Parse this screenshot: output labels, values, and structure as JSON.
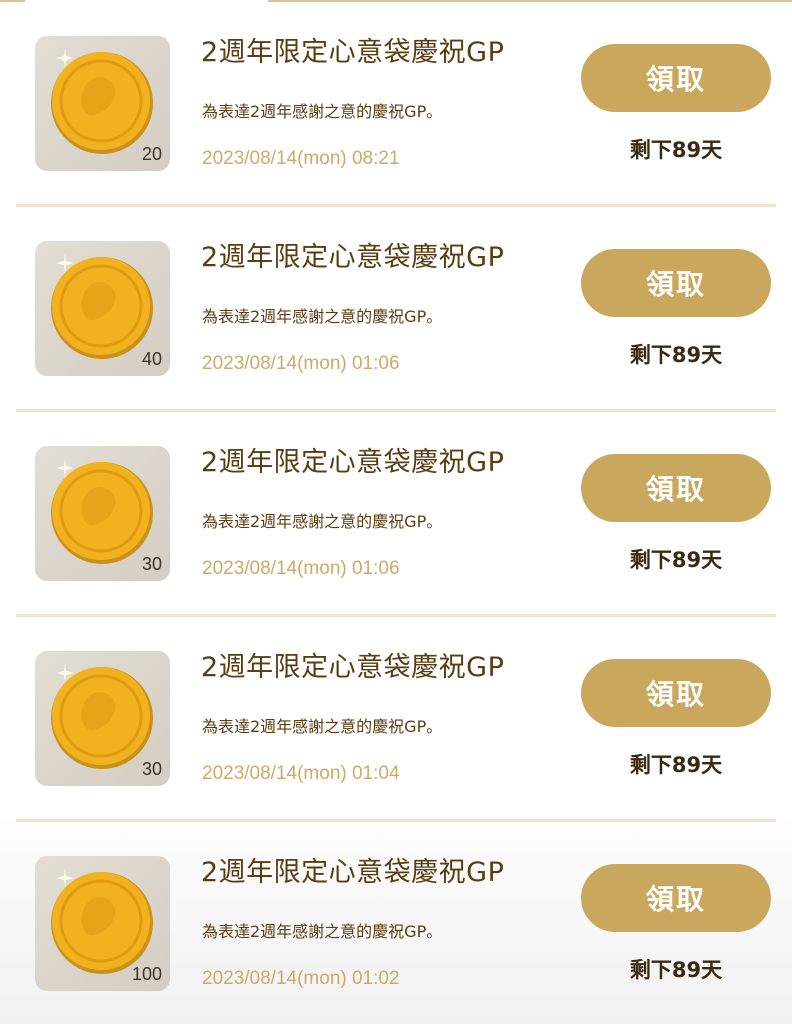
{
  "items": [
    {
      "title": "2週年限定心意袋慶祝GP",
      "desc": "為表達2週年感謝之意的慶祝GP。",
      "date": "2023/08/14(mon) 08:21",
      "count": "20",
      "claim_label": "領取",
      "remaining": "剩下89天",
      "icon": "gold-coin-icon"
    },
    {
      "title": "2週年限定心意袋慶祝GP",
      "desc": "為表達2週年感謝之意的慶祝GP。",
      "date": "2023/08/14(mon) 01:06",
      "count": "40",
      "claim_label": "領取",
      "remaining": "剩下89天",
      "icon": "gold-coin-icon"
    },
    {
      "title": "2週年限定心意袋慶祝GP",
      "desc": "為表達2週年感謝之意的慶祝GP。",
      "date": "2023/08/14(mon) 01:06",
      "count": "30",
      "claim_label": "領取",
      "remaining": "剩下89天",
      "icon": "gold-coin-icon"
    },
    {
      "title": "2週年限定心意袋慶祝GP",
      "desc": "為表達2週年感謝之意的慶祝GP。",
      "date": "2023/08/14(mon) 01:04",
      "count": "30",
      "claim_label": "領取",
      "remaining": "剩下89天",
      "icon": "gold-coin-icon"
    },
    {
      "title": "2週年限定心意袋慶祝GP",
      "desc": "為表達2週年感謝之意的慶祝GP。",
      "date": "2023/08/14(mon) 01:02",
      "count": "100",
      "claim_label": "領取",
      "remaining": "剩下89天",
      "icon": "gold-coin-icon"
    }
  ],
  "colors": {
    "accent": "#c9a85e",
    "title": "#5a3d12",
    "date": "#cfa968",
    "divider": "#f0e3cf"
  }
}
